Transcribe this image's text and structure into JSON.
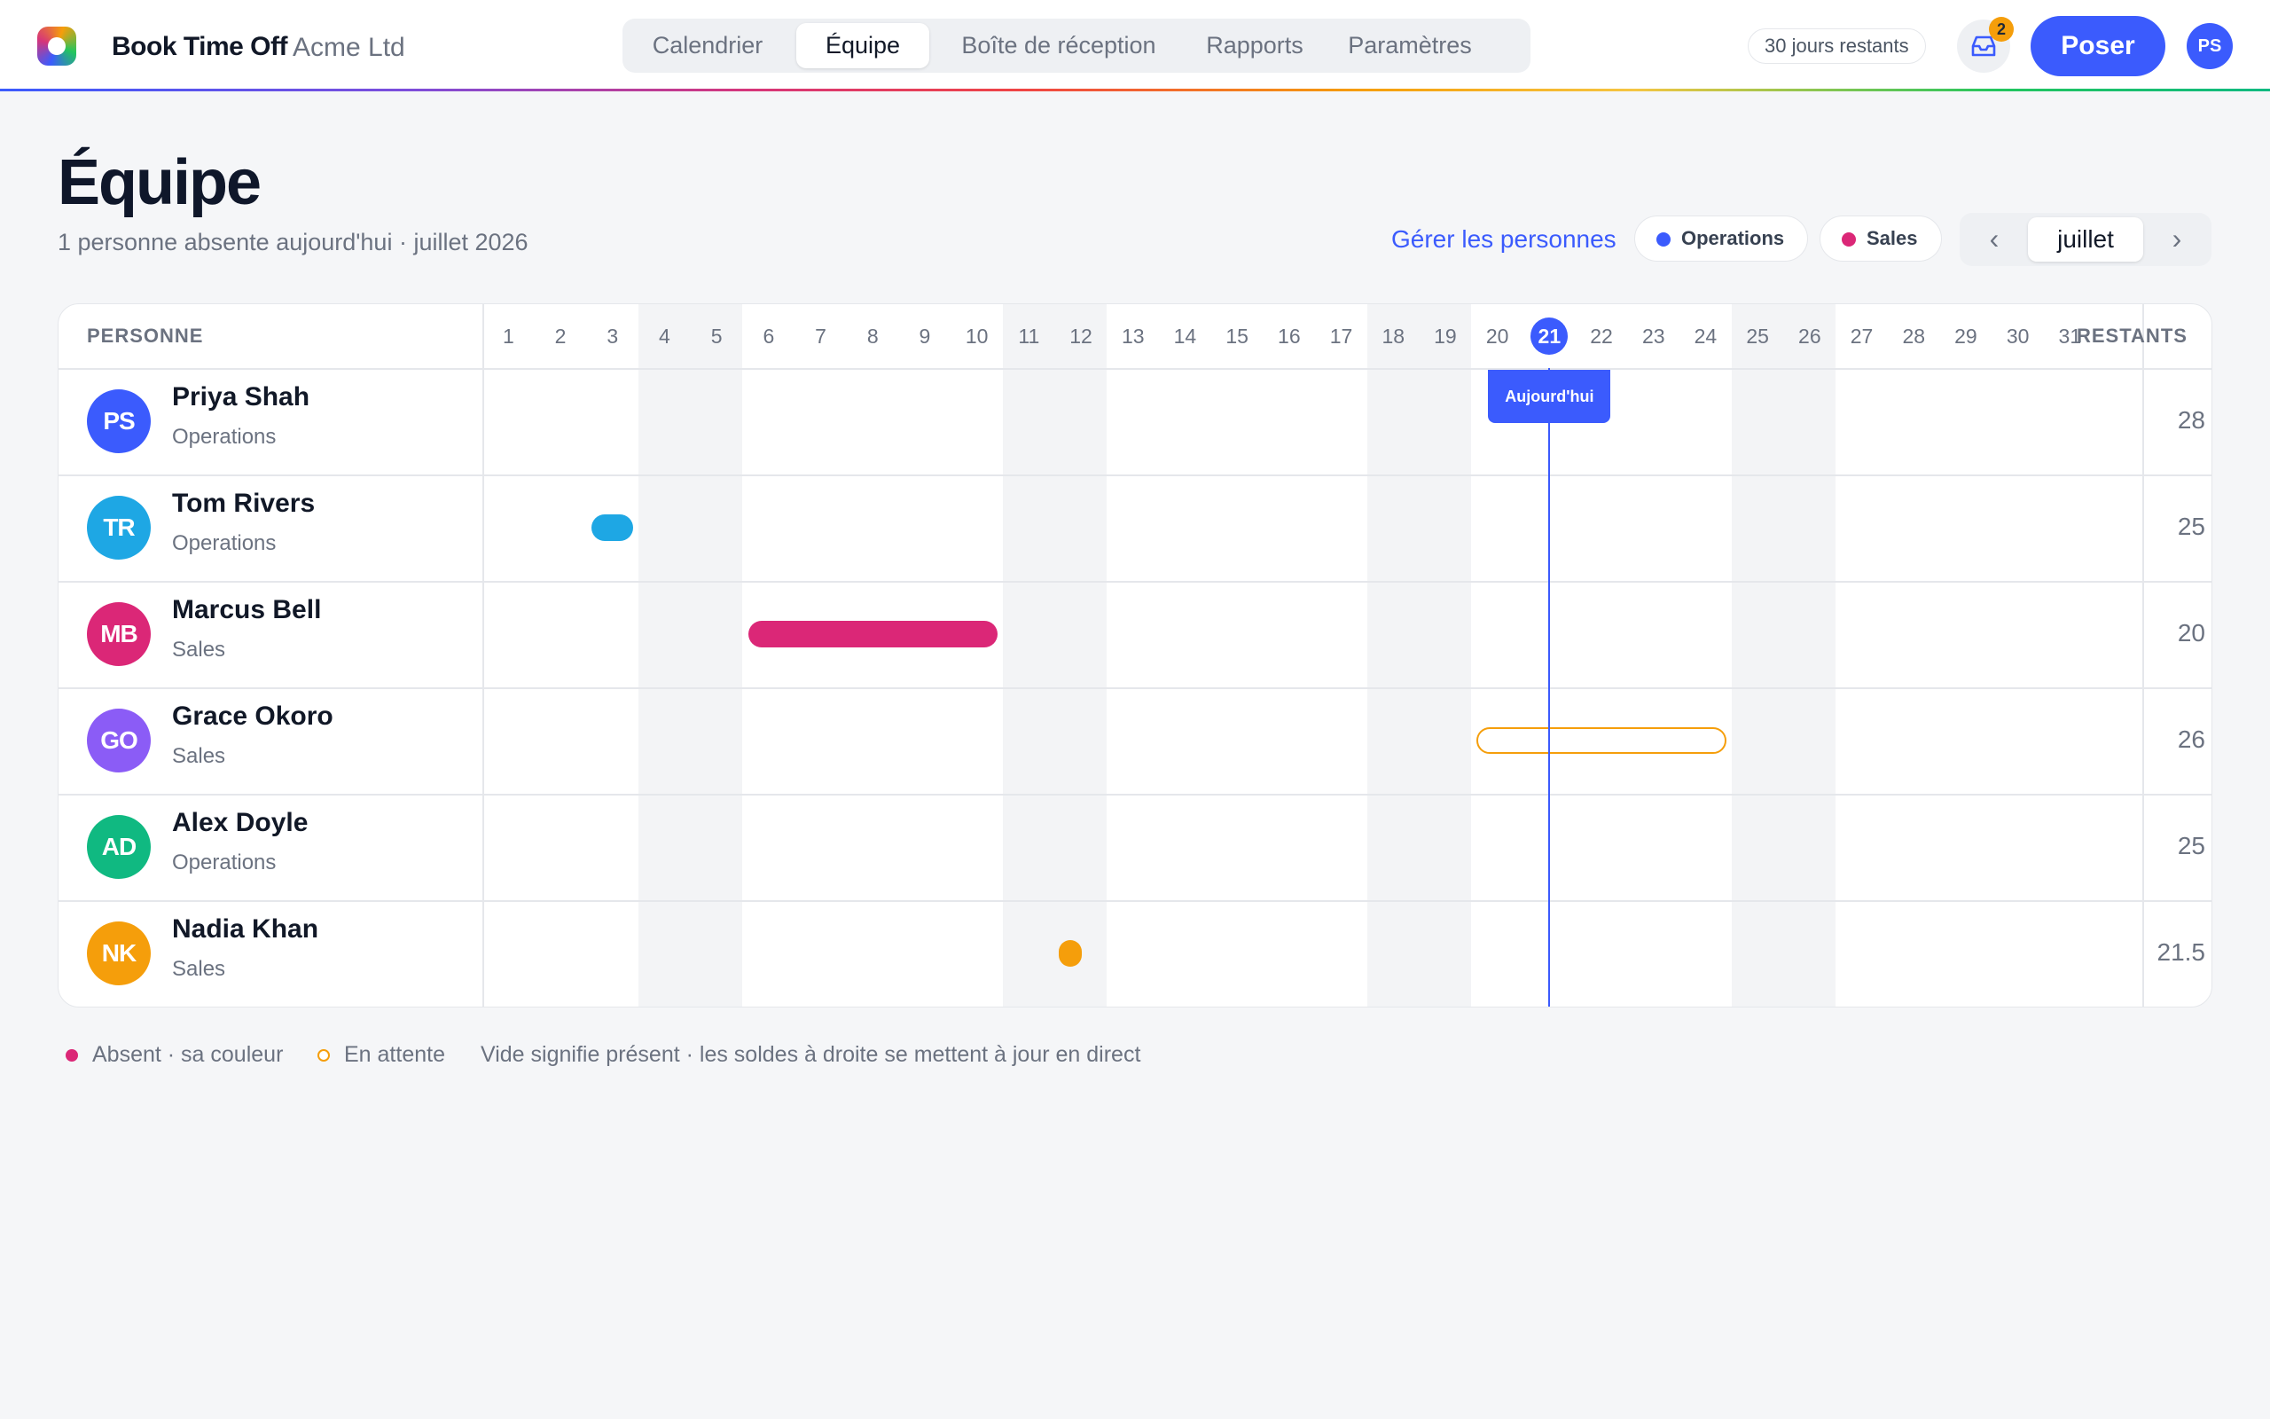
{
  "app": {
    "brand": "Book Time Off",
    "org": "Acme Ltd"
  },
  "nav": {
    "tabs": [
      {
        "label": "Calendrier"
      },
      {
        "label": "Équipe",
        "active": true
      },
      {
        "label": "Boîte de réception"
      },
      {
        "label": "Rapports"
      },
      {
        "label": "Paramètres"
      }
    ]
  },
  "header_right": {
    "days_left": "30 jours restants",
    "inbox_count": "2",
    "primary_action": "Poser",
    "user_initials": "PS"
  },
  "page": {
    "title": "Équipe",
    "subtitle": "1 personne absente aujourd'hui · juillet 2026",
    "manage_link": "Gérer les personnes",
    "filters": [
      {
        "label": "Operations",
        "color": "#3b5bfd"
      },
      {
        "label": "Sales",
        "color": "#db2777"
      }
    ],
    "month": {
      "prev": "‹",
      "current": "juillet",
      "next": "›"
    }
  },
  "grid": {
    "col_person": "PERSONNE",
    "col_remaining": "RESTANTS",
    "days": [
      "1",
      "2",
      "3",
      "4",
      "5",
      "6",
      "7",
      "8",
      "9",
      "10",
      "11",
      "12",
      "13",
      "14",
      "15",
      "16",
      "17",
      "18",
      "19",
      "20",
      "21",
      "22",
      "23",
      "24",
      "25",
      "26",
      "27",
      "28",
      "29",
      "30",
      "31"
    ],
    "today": 21,
    "today_label": "Aujourd'hui",
    "weekend_pairs": [
      [
        4,
        5
      ],
      [
        11,
        12
      ],
      [
        18,
        19
      ],
      [
        25,
        26
      ]
    ],
    "people": [
      {
        "initials": "PS",
        "name": "Priya Shah",
        "team": "Operations",
        "remaining": "28",
        "color": "#3b5bfd",
        "absences": []
      },
      {
        "initials": "TR",
        "name": "Tom Rivers",
        "team": "Operations",
        "remaining": "25",
        "color": "#1ea7e4",
        "absences": [
          {
            "start": 3,
            "end": 3,
            "color": "#1ea7e4",
            "status": "approved"
          }
        ]
      },
      {
        "initials": "MB",
        "name": "Marcus Bell",
        "team": "Sales",
        "remaining": "20",
        "color": "#db2777",
        "absences": [
          {
            "start": 6,
            "end": 10,
            "color": "#db2777",
            "status": "approved"
          }
        ]
      },
      {
        "initials": "GO",
        "name": "Grace Okoro",
        "team": "Sales",
        "remaining": "26",
        "color": "#8b5cf6",
        "absences": [
          {
            "start": 20,
            "end": 24,
            "color": "#f59e0b",
            "status": "pending"
          }
        ]
      },
      {
        "initials": "AD",
        "name": "Alex Doyle",
        "team": "Operations",
        "remaining": "25",
        "color": "#10b981",
        "absences": []
      },
      {
        "initials": "NK",
        "name": "Nadia Khan",
        "team": "Sales",
        "remaining": "21.5",
        "color": "#f59e0b",
        "absences": [
          {
            "start": 12,
            "end": 12,
            "color": "#f59e0b",
            "status": "approved",
            "half_day": true
          }
        ]
      }
    ]
  },
  "legend": {
    "absent": "Absent · sa couleur",
    "pending": "En attente",
    "note": "Vide signifie présent · les soldes à droite se mettent à jour en direct",
    "absent_color": "#db2777",
    "pending_color": "#f59e0b"
  }
}
